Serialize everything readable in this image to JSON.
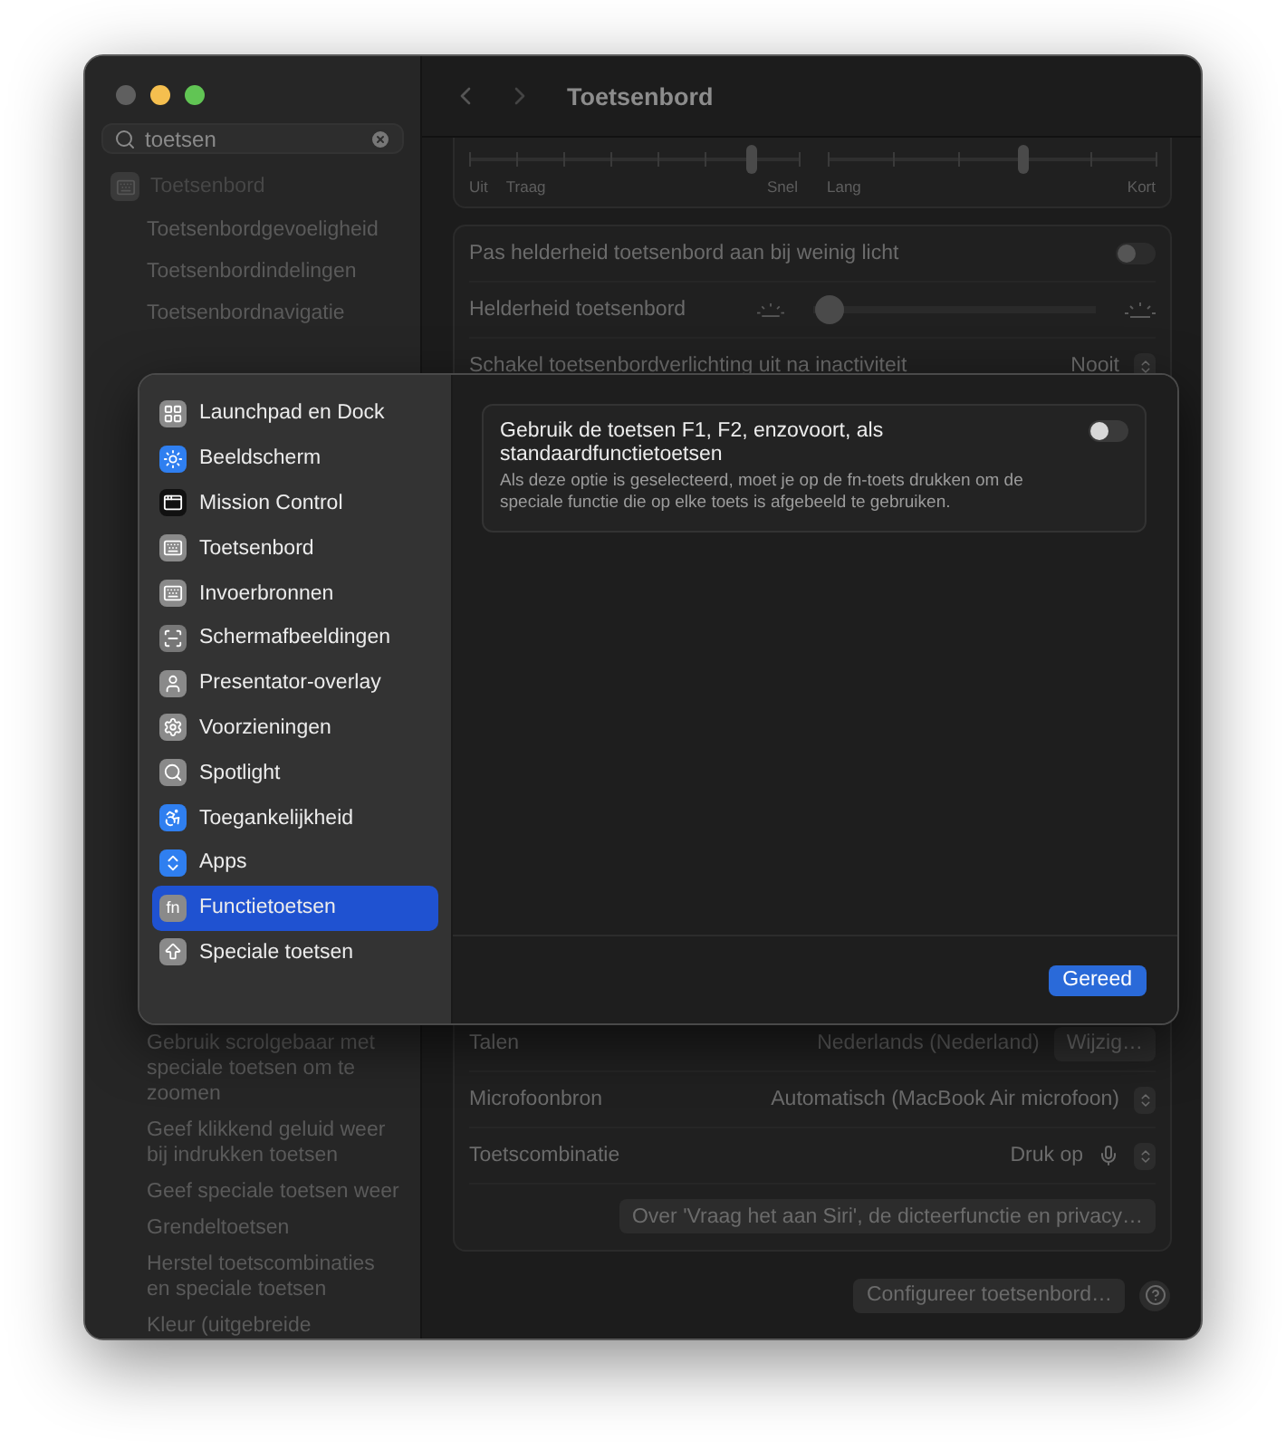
{
  "window": {
    "title": "Toetsenbord"
  },
  "sidebar": {
    "search": {
      "value": "toetsen"
    },
    "items": [
      {
        "label": "Toetsenbord",
        "kind": "pane"
      },
      {
        "label": "Toetsenbordgevoeligheid",
        "kind": "result"
      },
      {
        "label": "Toetsenbordindelingen",
        "kind": "result"
      },
      {
        "label": "Toetsenbordnavigatie",
        "kind": "result"
      }
    ],
    "lower_items": [
      {
        "label": "Gebruik scrolgebaar met speciale toetsen om te zoomen"
      },
      {
        "label": "Geef klikkend geluid weer bij indrukken toetsen"
      },
      {
        "label": "Geef speciale toetsen weer"
      },
      {
        "label": "Grendeltoetsen"
      },
      {
        "label": "Herstel toetscombinaties en speciale toetsen"
      },
      {
        "label": "Kleur (uitgebreide"
      }
    ]
  },
  "main": {
    "sliders": [
      {
        "level": 0.857,
        "labels": [
          "Uit",
          "Traag",
          "Snel"
        ]
      },
      {
        "level": 0.6,
        "labels": [
          "Lang",
          "Kort"
        ]
      }
    ],
    "settings": [
      {
        "kind": "toggle",
        "label": "Pas helderheid toetsenbord aan bij weinig licht",
        "on": false
      },
      {
        "kind": "slider",
        "label": "Helderheid toetsenbord",
        "level": 0.06
      },
      {
        "kind": "popup",
        "label": "Schakel toetsenbordverlichting uit na inactiviteit",
        "value": "Nooit"
      }
    ],
    "dictation": [
      {
        "kind": "button",
        "label": "Talen",
        "value": "Nederlands (Nederland)",
        "button": "Wijzig…"
      },
      {
        "kind": "popup",
        "label": "Microfoonbron",
        "value": "Automatisch (MacBook Air microfoon)"
      },
      {
        "kind": "mic",
        "label": "Toetscombinatie",
        "value": "Druk op"
      },
      {
        "kind": "link",
        "button": "Over 'Vraag het aan Siri', de dicteerfunctie en privacy…"
      }
    ],
    "footer_button": "Configureer toetsenbord…"
  },
  "sheet": {
    "categories": [
      {
        "label": "Launchpad en Dock",
        "selected": false
      },
      {
        "label": "Beeldscherm",
        "selected": false
      },
      {
        "label": "Mission Control",
        "selected": false
      },
      {
        "label": "Toetsenbord",
        "selected": false
      },
      {
        "label": "Invoerbronnen",
        "selected": false
      },
      {
        "label": "Schermafbeeldingen",
        "selected": false
      },
      {
        "label": "Presentator-overlay",
        "selected": false
      },
      {
        "label": "Voorzieningen",
        "selected": false
      },
      {
        "label": "Spotlight",
        "selected": false
      },
      {
        "label": "Toegankelijkheid",
        "selected": false
      },
      {
        "label": "Apps",
        "selected": false
      },
      {
        "label": "Functietoetsen",
        "selected": true,
        "glyph": "fn"
      },
      {
        "label": "Speciale toetsen",
        "selected": false
      }
    ],
    "option": {
      "title": "Gebruik de toetsen F1, F2, enzovoort, als standaardfunctietoetsen",
      "description": "Als deze optie is geselecteerd, moet je op de fn-toets drukken om de speciale functie die op elke toets is afgebeeld te gebruiken.",
      "on": false
    },
    "done_button": "Gereed"
  }
}
